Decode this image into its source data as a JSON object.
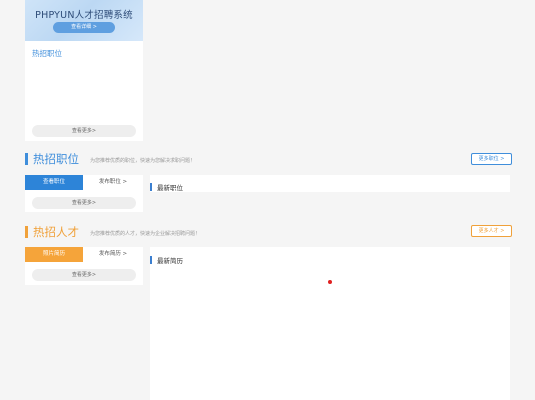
{
  "banner": {
    "title": "PHPYUN人才招聘系统",
    "button_label": "查看详细 >"
  },
  "hot_jobs_sidebar": {
    "label": "热招职位",
    "more_label": "查看更多>"
  },
  "jobs_section": {
    "title": "热招职位",
    "subtitle": "为您推荐优质的职位，快速为您解决求职问题！",
    "more_button": "更多职位 >",
    "tab_active": "查看职位",
    "tab_inactive": "发布职位 >",
    "more_label": "查看更多>",
    "panel_title": "最新职位"
  },
  "talent_section": {
    "title": "热招人才",
    "subtitle": "为您推荐优质的人才，快速为企业解决招聘问题！",
    "more_button": "更多人才 >",
    "tab_active": "照片简历",
    "tab_inactive": "发布简历 >",
    "more_label": "查看更多>",
    "panel_title": "最新简历"
  },
  "colors": {
    "blue_accent": "#3f8edb",
    "orange_accent": "#f0a13a",
    "red_dot": "#e02020"
  }
}
